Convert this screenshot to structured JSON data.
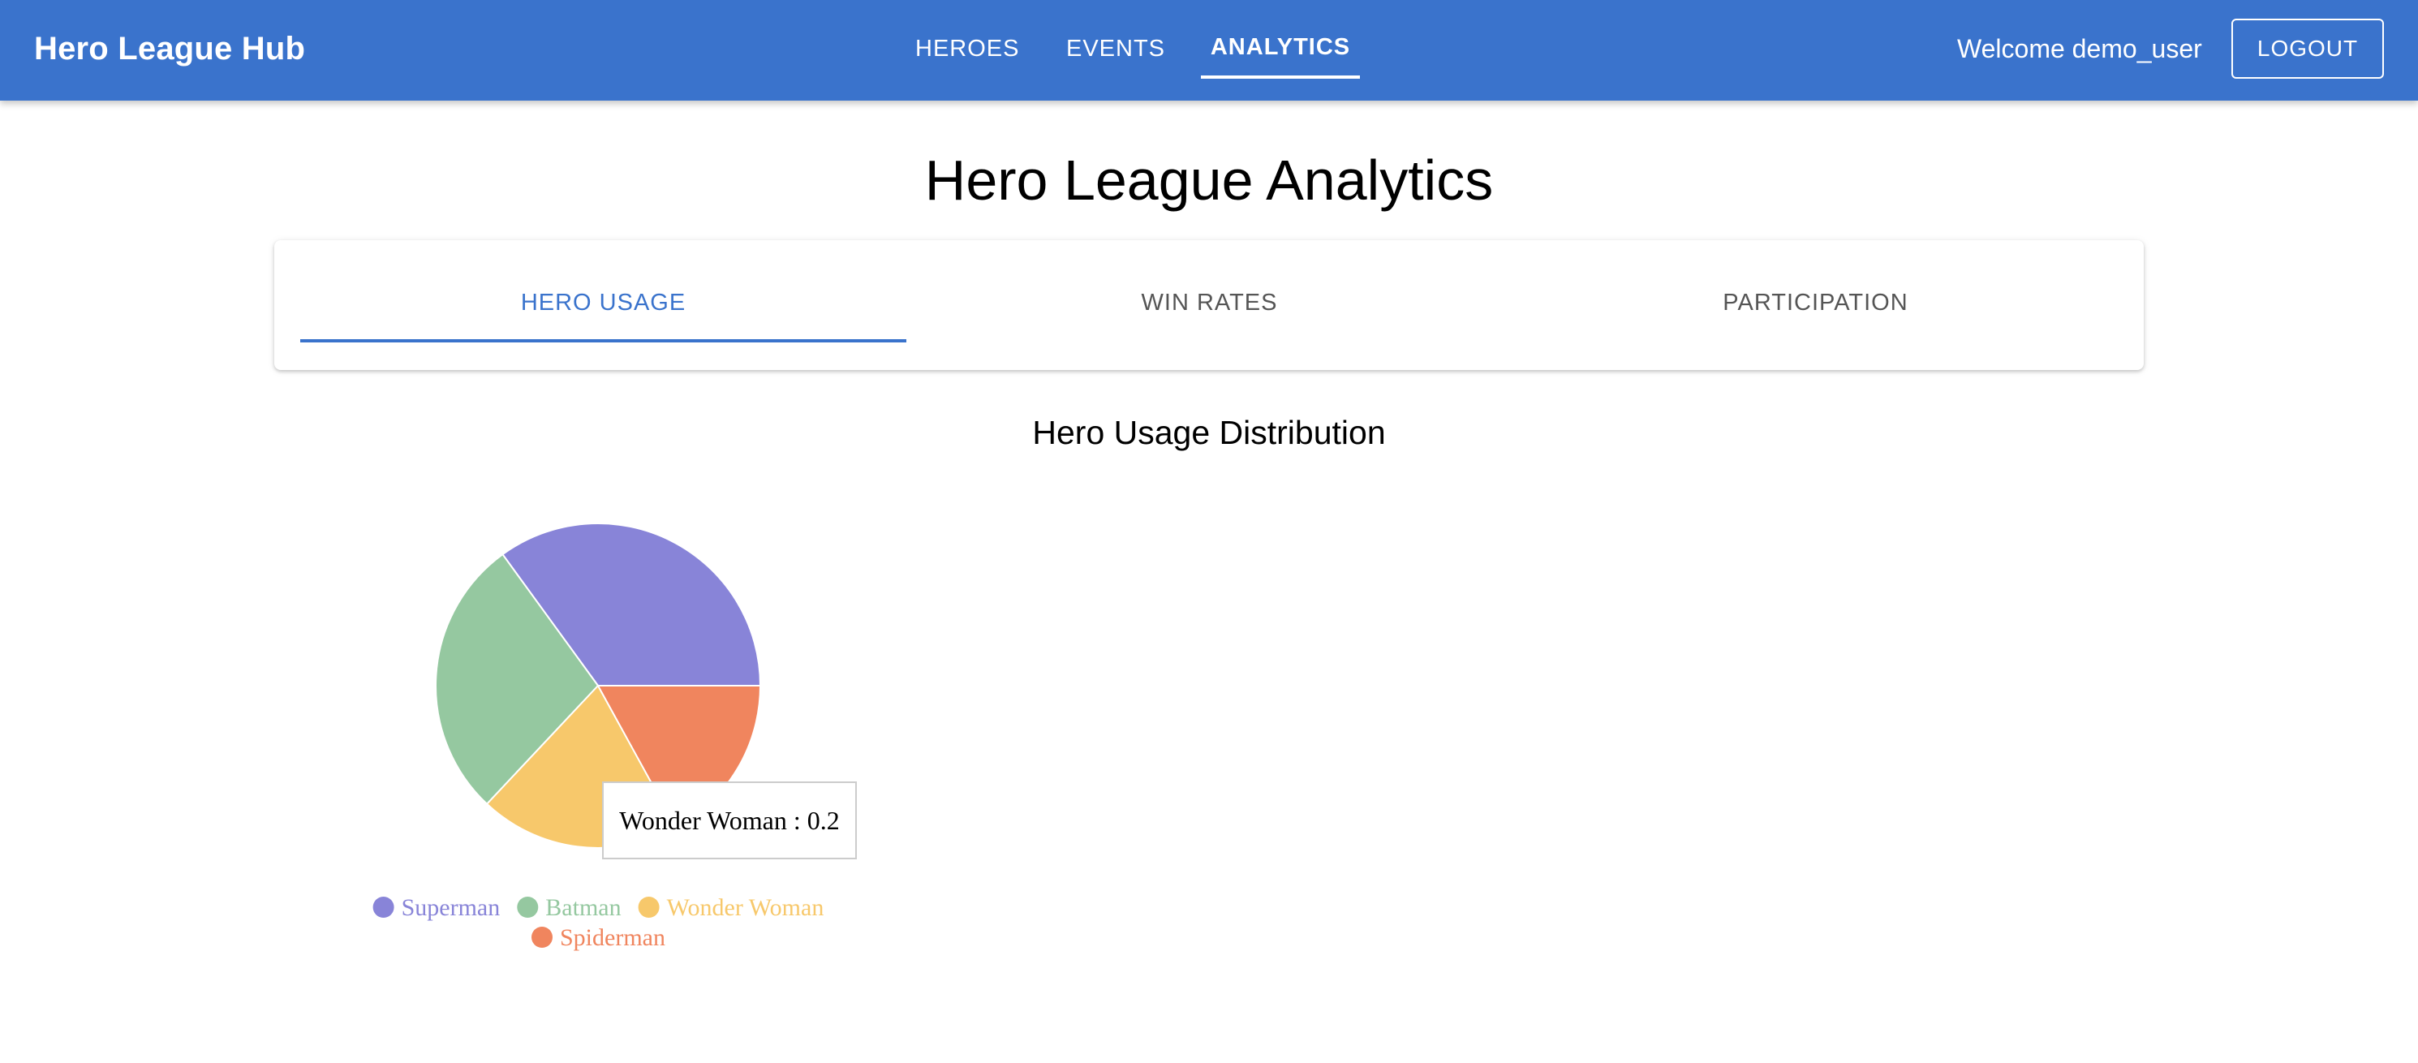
{
  "app": {
    "title": "Hero League Hub",
    "nav": [
      {
        "label": "HEROES",
        "active": false
      },
      {
        "label": "EVENTS",
        "active": false
      },
      {
        "label": "ANALYTICS",
        "active": true
      }
    ],
    "welcome": "Welcome demo_user",
    "logout_label": "LOGOUT"
  },
  "page": {
    "title": "Hero League Analytics",
    "tabs": [
      {
        "label": "HERO USAGE",
        "active": true
      },
      {
        "label": "WIN RATES",
        "active": false
      },
      {
        "label": "PARTICIPATION",
        "active": false
      }
    ],
    "section_title": "Hero Usage Distribution"
  },
  "colors": {
    "appbar": "#3a73cc",
    "accent": "#3a73cc"
  },
  "tooltip": {
    "label": "Wonder Woman",
    "value": 0.2,
    "text": "Wonder Woman : 0.2"
  },
  "chart_data": {
    "type": "pie",
    "title": "Hero Usage Distribution",
    "start_angle_deg": 0,
    "direction": "counterclockwise",
    "legend_position": "bottom",
    "slices": [
      {
        "name": "Superman",
        "value": 0.35,
        "color": "#8884d8"
      },
      {
        "name": "Batman",
        "value": 0.28,
        "color": "#95c8a0"
      },
      {
        "name": "Wonder Woman",
        "value": 0.2,
        "color": "#f7c86b"
      },
      {
        "name": "Spiderman",
        "value": 0.17,
        "color": "#f0855e"
      }
    ]
  }
}
